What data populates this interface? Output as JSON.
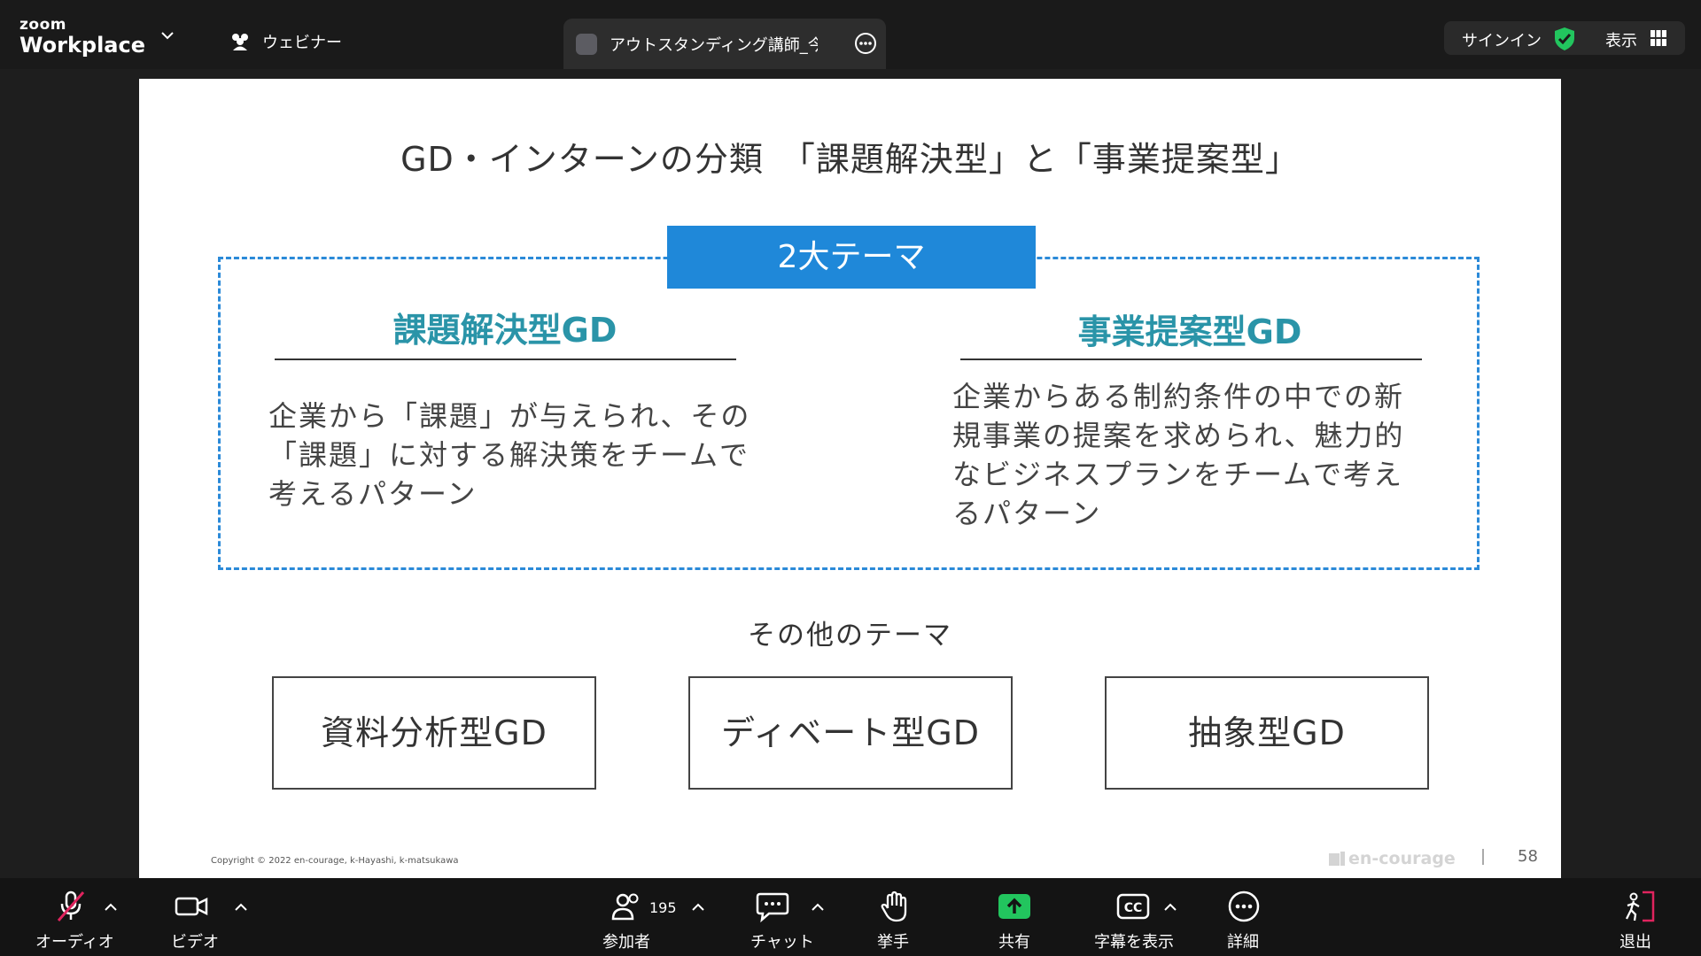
{
  "app": {
    "logo_top": "zoom",
    "logo_bottom": "Workplace"
  },
  "top_bar": {
    "webinar_label": "ウェビナー",
    "tab_title": "アウトスタンディング講師_今尾 さんの",
    "signin_label": "サインイン",
    "view_label": "表示"
  },
  "slide": {
    "title": "GD・インターンの分類　「課題解決型」と「事業提案型」",
    "theme_banner": "2大テーマ",
    "left_title": "課題解決型GD",
    "left_body": "企業から「課題」が与えられ、その「課題」に対する解決策をチームで考えるパターン",
    "right_title": "事業提案型GD",
    "right_body": "企業からある制約条件の中での新規事業の提案を求められ、魅力的なビジネスプランをチームで考えるパターン",
    "other_label": "その他のテーマ",
    "other_items": [
      "資料分析型GD",
      "ディベート型GD",
      "抽象型GD"
    ],
    "copyright": "Copyright © 2022 en-courage, k-Hayashi, k-matsukawa",
    "brand": "en-courage",
    "page_number": "58"
  },
  "toolbar": {
    "audio": "オーディオ",
    "video": "ビデオ",
    "participants": "参加者",
    "participants_count": "195",
    "chat": "チャット",
    "raise_hand": "挙手",
    "share": "共有",
    "captions": "字幕を表示",
    "more": "詳細",
    "leave": "退出"
  },
  "colors": {
    "accent_blue": "#1f88d9",
    "title_teal": "#2a94a8",
    "share_green": "#22c55e",
    "leave_red": "#e0245e",
    "shield_green": "#22c55e"
  }
}
